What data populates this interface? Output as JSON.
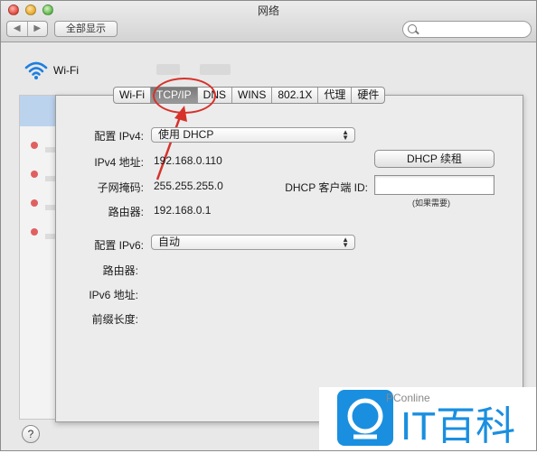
{
  "window": {
    "title": "网络"
  },
  "toolbar": {
    "back_glyph": "◀",
    "forward_glyph": "▶",
    "show_all_label": "全部显示",
    "search_placeholder": ""
  },
  "service": {
    "name": "Wi-Fi"
  },
  "tabs": [
    {
      "label": "Wi-Fi",
      "active": false
    },
    {
      "label": "TCP/IP",
      "active": true
    },
    {
      "label": "DNS",
      "active": false
    },
    {
      "label": "WINS",
      "active": false
    },
    {
      "label": "802.1X",
      "active": false
    },
    {
      "label": "代理",
      "active": false
    },
    {
      "label": "硬件",
      "active": false
    }
  ],
  "ipv4": {
    "configure_label": "配置 IPv4:",
    "configure_value": "使用 DHCP",
    "address_label": "IPv4 地址:",
    "address_value": "192.168.0.110",
    "renew_button": "DHCP 续租",
    "subnet_label": "子网掩码:",
    "subnet_value": "255.255.255.0",
    "client_id_label": "DHCP 客户端 ID:",
    "client_id_value": "",
    "client_id_hint": "(如果需要)",
    "router_label": "路由器:",
    "router_value": "192.168.0.1"
  },
  "ipv6": {
    "configure_label": "配置 IPv6:",
    "configure_value": "自动",
    "router_label": "路由器:",
    "router_value": "",
    "address_label": "IPv6 地址:",
    "address_value": "",
    "prefix_label": "前缀长度:",
    "prefix_value": ""
  },
  "help": {
    "glyph": "?"
  },
  "watermark": {
    "brand": "PConline",
    "text": "IT百科"
  },
  "colors": {
    "accent_red": "#d6322b",
    "watermark_blue": "#1a8fe0",
    "active_tab": "#8a8a8a"
  }
}
